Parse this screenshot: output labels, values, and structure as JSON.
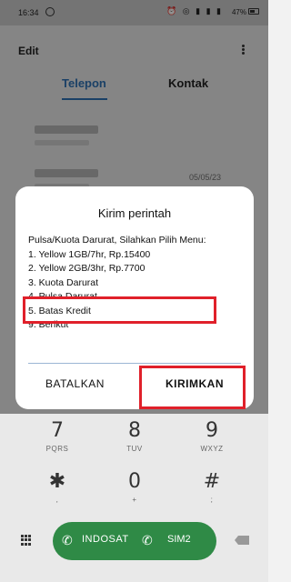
{
  "status_bar": {
    "time": "16:34",
    "battery": "47%"
  },
  "header": {
    "edit_label": "Edit"
  },
  "tabs": [
    {
      "label": "Telepon"
    },
    {
      "label": "Kontak"
    }
  ],
  "call_log": [
    {
      "date": ""
    },
    {
      "date": "05/05/23"
    }
  ],
  "dialog": {
    "title": "Kirim perintah",
    "lines": [
      "Pulsa/Kuota Darurat, Silahkan Pilih Menu:",
      "1. Yellow 1GB/7hr, Rp.15400",
      "2. Yellow 2GB/3hr, Rp.7700",
      "3. Kuota Darurat",
      "4. Pulsa Darurat",
      "5. Batas Kredit",
      "9. Berikut"
    ],
    "cancel_label": "BATALKAN",
    "send_label": "KIRIMKAN"
  },
  "keypad": {
    "keys": [
      {
        "digit": "7",
        "letters": "PQRS"
      },
      {
        "digit": "8",
        "letters": "TUV"
      },
      {
        "digit": "9",
        "letters": "WXYZ"
      },
      {
        "digit": "✱",
        "letters": ","
      },
      {
        "digit": "0",
        "letters": "+"
      },
      {
        "digit": "#",
        "letters": ";"
      }
    ]
  },
  "call_button": {
    "sim1": "INDOSAT",
    "sim2": "SIM2",
    "accent_color": "#2f8a46"
  },
  "highlight_color": "#e0202a"
}
